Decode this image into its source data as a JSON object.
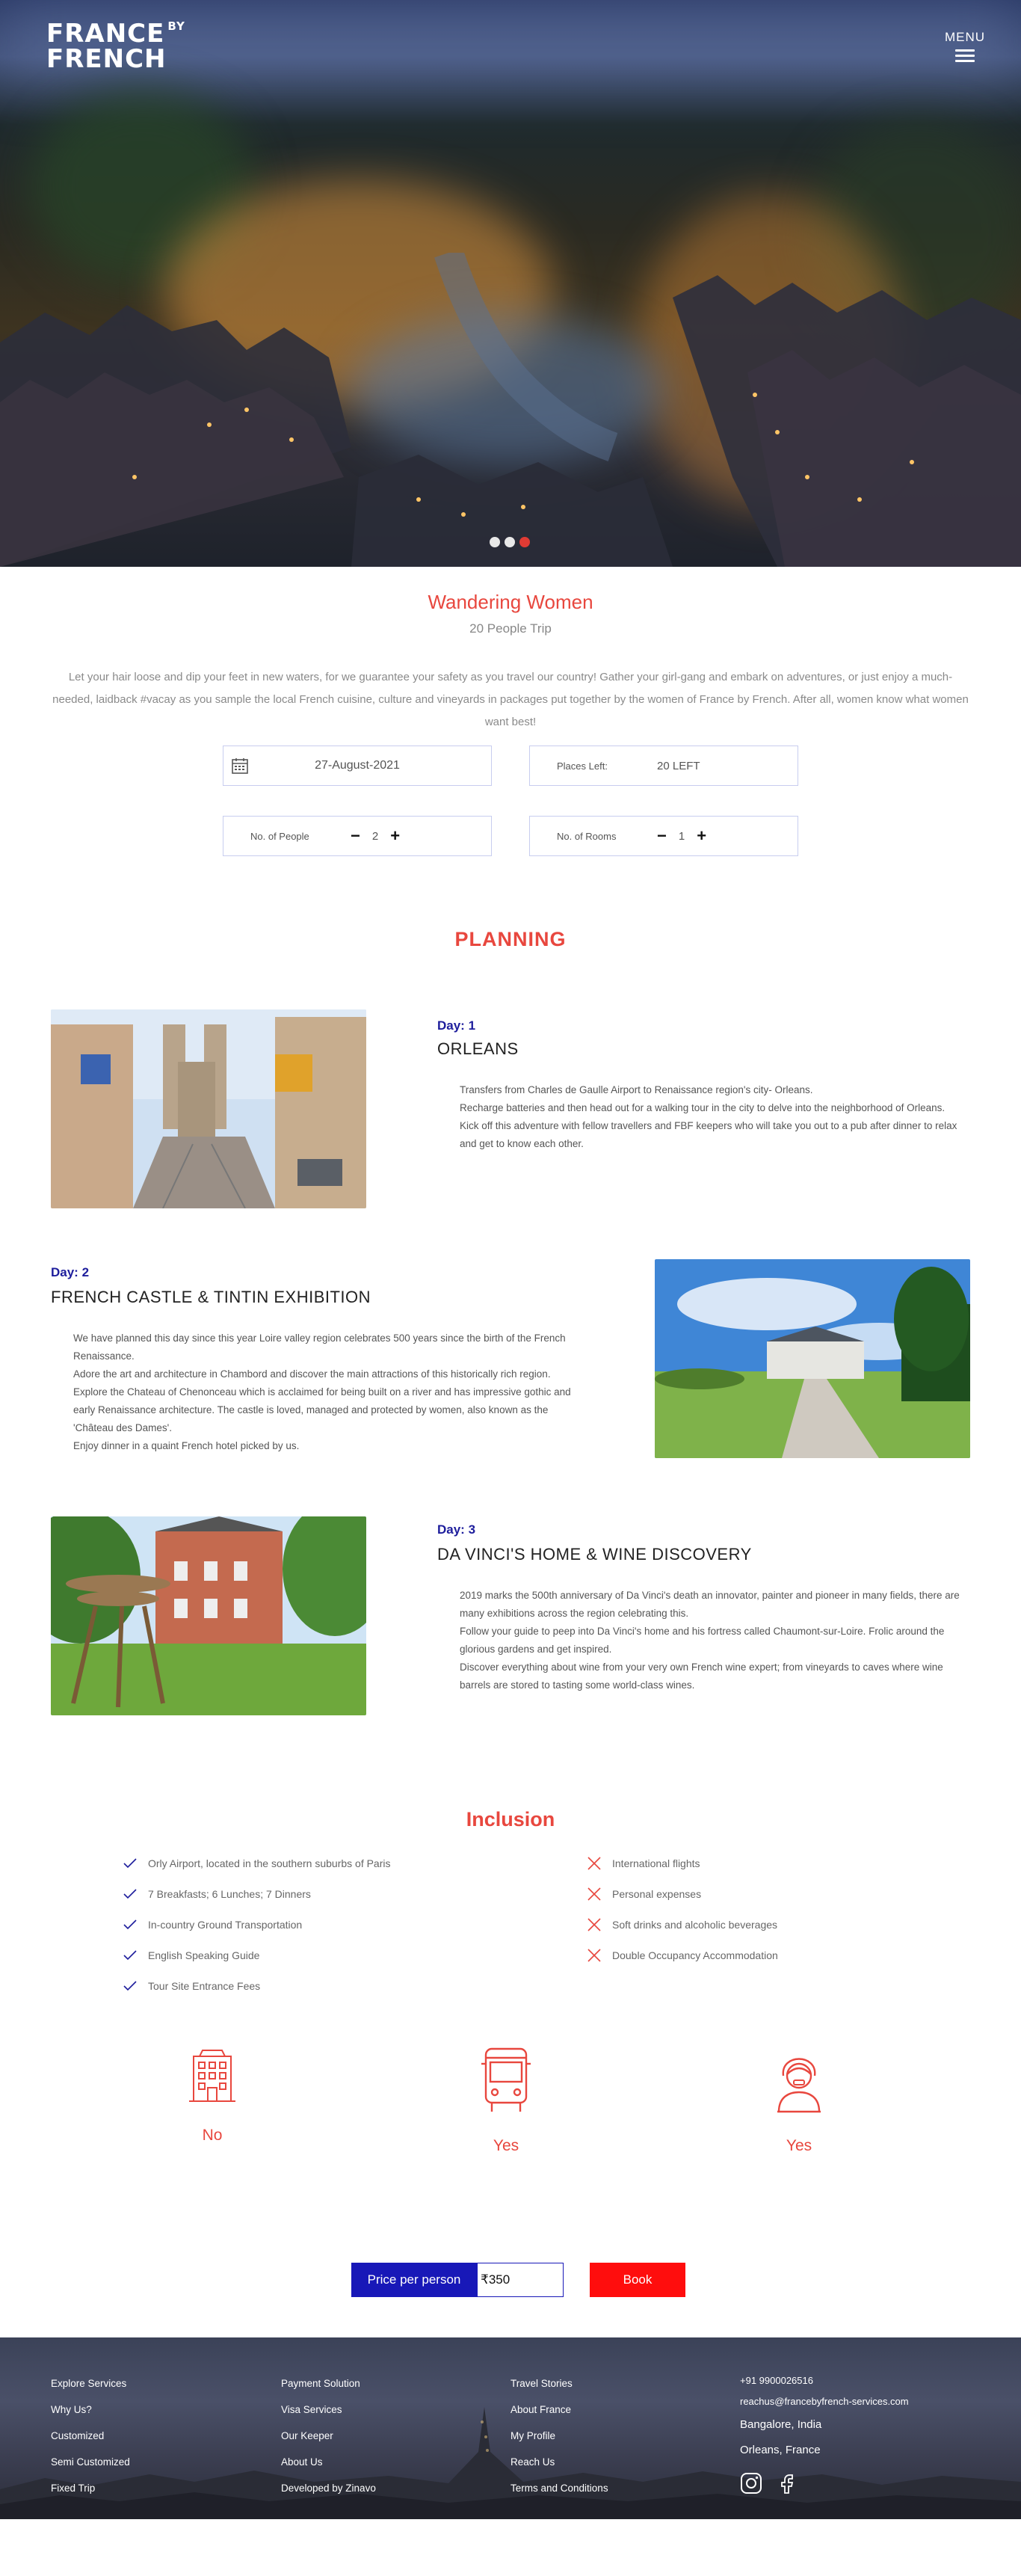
{
  "header": {
    "logo_line1": "FRANCE",
    "logo_by": "BY",
    "logo_line2": "FRENCH",
    "menu_label": "MENU"
  },
  "trip": {
    "title": "Wandering Women",
    "subtitle": "20 People Trip",
    "description": "Let your hair loose and dip your feet in new waters, for we guarantee your safety as you travel our country! Gather your girl-gang and embark on adventures, or just enjoy a much-needed, laidback #vacay as you sample the local French cuisine, culture and vineyards in packages put together by the women of France by French. After all, women know what women want best!",
    "date": "27-August-2021",
    "places_label": "Places Left:",
    "places_value": "20 LEFT",
    "people_label": "No. of People",
    "people_value": "2",
    "rooms_label": "No. of Rooms",
    "rooms_value": "1",
    "minus": "−",
    "plus": "+"
  },
  "planning": {
    "title": "PLANNING",
    "days": [
      {
        "label": "Day: 1",
        "title": "ORLEANS",
        "paragraphs": [
          "Transfers from Charles de Gaulle Airport to Renaissance region's city- Orleans.",
          "Recharge batteries and then head out for a walking tour in the city to delve into the neighborhood of Orleans.",
          "Kick off this adventure with fellow travellers and FBF keepers who will take you out to a pub after dinner to relax and get to know each other."
        ]
      },
      {
        "label": "Day: 2",
        "title": "FRENCH CASTLE & TINTIN EXHIBITION",
        "paragraphs": [
          "We have planned this day since this year Loire valley region celebrates 500 years since the birth of the French Renaissance.",
          "Adore the art and architecture in Chambord and discover the main attractions of this historically rich region.",
          "Explore the Chateau of Chenonceau which is acclaimed for being built on a river and has impressive gothic and early Renaissance architecture. The castle is loved, managed and protected by women, also known as the 'Château des Dames'.",
          "Enjoy dinner in a quaint French hotel picked by us."
        ]
      },
      {
        "label": "Day: 3",
        "title": "DA VINCI'S HOME & WINE DISCOVERY",
        "paragraphs": [
          "2019 marks the 500th anniversary of Da Vinci's death an innovator, painter and pioneer in many fields, there are many exhibitions across the region celebrating this.",
          "Follow your guide to peep into Da Vinci's home and his fortress called Chaumont-sur-Loire. Frolic around the glorious gardens and get inspired.",
          "Discover everything about wine from your very own French wine expert; from vineyards to caves where wine barrels are stored to tasting some world-class wines."
        ]
      }
    ]
  },
  "inclusion": {
    "title": "Inclusion",
    "included": [
      "Orly Airport, located in the southern suburbs of Paris",
      "7 Breakfasts; 6 Lunches; 7 Dinners",
      "In-country Ground Transportation",
      "English Speaking Guide",
      "Tour Site Entrance Fees"
    ],
    "excluded": [
      "International flights",
      "Personal expenses",
      "Soft drinks and alcoholic beverages",
      "Double Occupancy Accommodation"
    ],
    "check_color": "#1d1d9c",
    "cross_color": "#e8473e"
  },
  "amenities": [
    {
      "icon": "hotel-icon",
      "value": "No"
    },
    {
      "icon": "bus-icon",
      "value": "Yes"
    },
    {
      "icon": "guide-icon",
      "value": "Yes"
    }
  ],
  "price": {
    "label": "Price per person",
    "value": "₹350",
    "book_label": "Book",
    "accent": "#1818b8",
    "book_color": "#ff0d0d"
  },
  "footer": {
    "col1": [
      "Explore Services",
      "Why Us?",
      "Customized",
      "Semi Customized",
      "Fixed Trip"
    ],
    "col2": [
      "Payment Solution",
      "Visa Services",
      "Our Keeper",
      "About Us",
      "Developed by Zinavo"
    ],
    "col3": [
      "Travel Stories",
      "About France",
      "My Profile",
      "Reach Us",
      "Terms and Conditions"
    ],
    "phone": "+91 9900026516",
    "email": "reachus@francebyfrench-services.com",
    "location1": "Bangalore, India",
    "location2": "Orleans, France"
  }
}
